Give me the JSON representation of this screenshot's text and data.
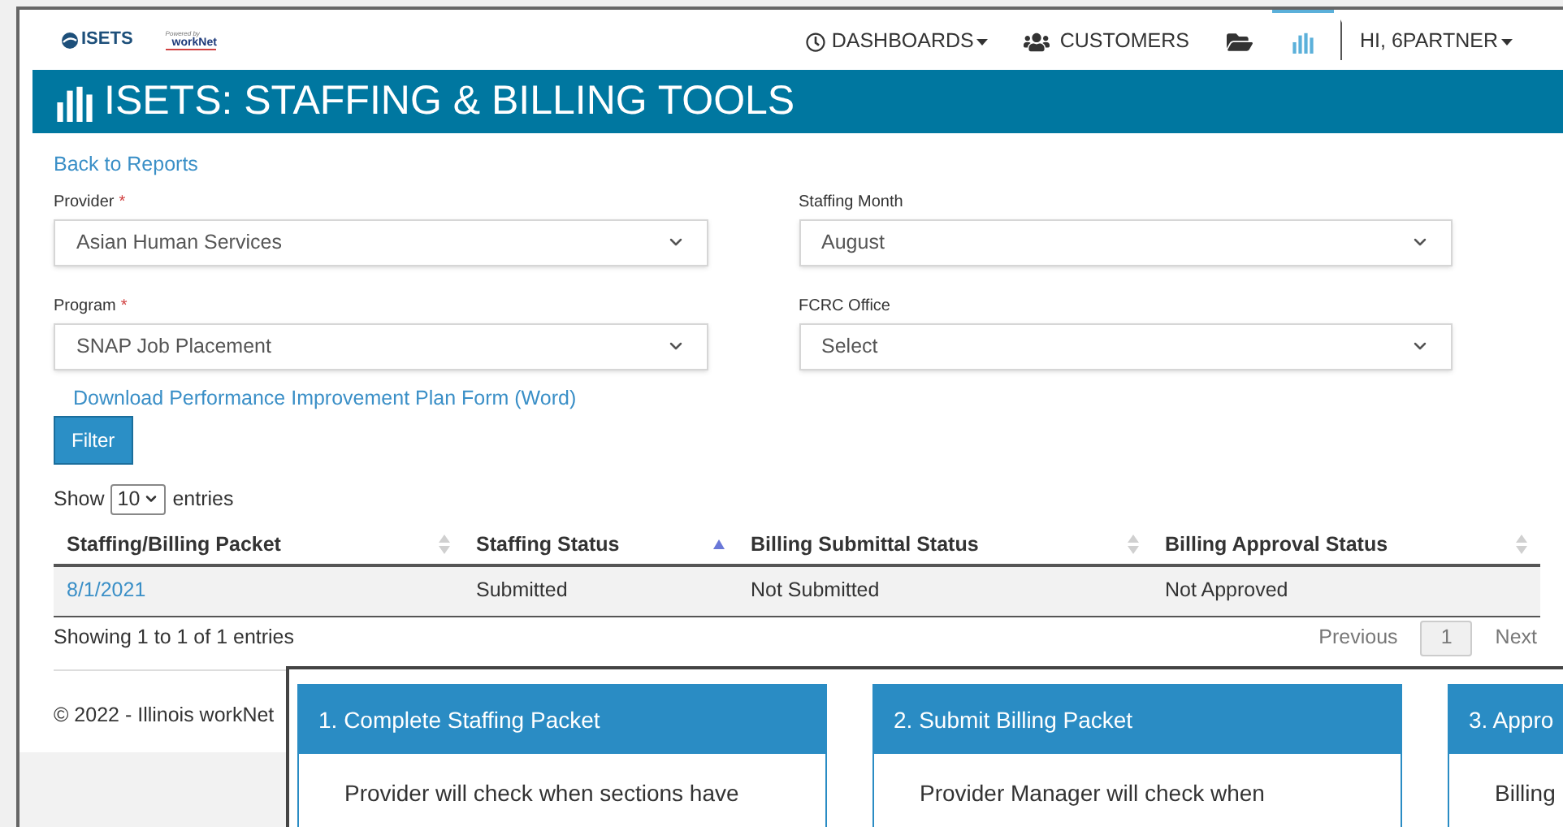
{
  "header": {
    "logo": "ISETS",
    "partner_logo": {
      "caption": "Powered by",
      "name": "workNet"
    },
    "nav": [
      {
        "kind": "dashboards",
        "label": "DASHBOARDS",
        "selected": false
      },
      {
        "kind": "customers",
        "label": "CUSTOMERS",
        "selected": false
      },
      {
        "kind": "folder",
        "selected": false
      },
      {
        "kind": "reports",
        "selected": true
      },
      {
        "kind": "user",
        "label": "HI, 6PARTNER",
        "selected": false
      }
    ]
  },
  "banner": {
    "title": "ISETS: STAFFING & BILLING TOOLS"
  },
  "back_link": "Back to Reports",
  "filters": [
    {
      "label": "Provider",
      "marker": "*",
      "value": "Asian Human Services"
    },
    {
      "label": "Staffing Month",
      "value": "August"
    },
    {
      "label": "Program",
      "marker": "*",
      "value": "SNAP Job Placement"
    },
    {
      "label": "FCRC Office",
      "value": "Select"
    }
  ],
  "download_link": "Download Performance Improvement Plan Form (Word)",
  "filter_button": "Filter",
  "table": {
    "show_label": "Show",
    "page_size": "10",
    "entries_label": "entries",
    "columns": [
      {
        "label": "Staffing/Billing Packet",
        "sorted": false
      },
      {
        "label": "Staffing Status",
        "sorted": true
      },
      {
        "label": "Billing Submittal Status",
        "sorted": false
      },
      {
        "label": "Billing Approval Status",
        "sorted": false
      }
    ],
    "rows": [
      [
        "8/1/2021",
        "Submitted",
        "Not Submitted",
        "Not Approved"
      ]
    ],
    "info": "Showing 1 to 1 of 1 entries",
    "pagination": {
      "previous": "Previous",
      "pages": [
        {
          "label": "1",
          "selected": true
        }
      ],
      "next": "Next"
    }
  },
  "footer": "© 2022 - Illinois workNet",
  "steps": [
    {
      "title": "1. Complete Staffing Packet",
      "body": "Provider will check when sections have"
    },
    {
      "title": "2. Submit Billing Packet",
      "body": "Provider Manager will check when"
    },
    {
      "title": "3. Appro",
      "body": "Billing"
    }
  ]
}
